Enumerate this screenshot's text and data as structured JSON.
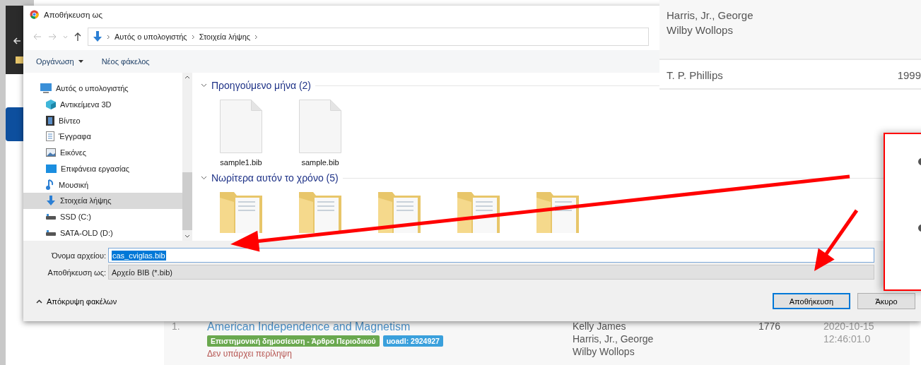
{
  "dialog": {
    "title": "Αποθήκευση ως",
    "breadcrumb": [
      "Αυτός ο υπολογιστής",
      "Στοιχεία λήψης"
    ],
    "toolbar": [
      {
        "label": "Οργάνωση",
        "dropdown": true
      },
      {
        "label": "Νέος φάκελος",
        "dropdown": false
      }
    ],
    "nav_items": [
      {
        "label": "Αυτός ο υπολογιστής",
        "kind": "computer",
        "selected": false
      },
      {
        "label": "Αντικείμενα 3D",
        "kind": "cube",
        "selected": false
      },
      {
        "label": "Βίντεο",
        "kind": "film",
        "selected": false
      },
      {
        "label": "Έγγραφα",
        "kind": "document",
        "selected": false
      },
      {
        "label": "Εικόνες",
        "kind": "picture",
        "selected": false
      },
      {
        "label": "Επιφάνεια εργασίας",
        "kind": "desktop",
        "selected": false
      },
      {
        "label": "Μουσική",
        "kind": "music",
        "selected": false
      },
      {
        "label": "Στοιχεία λήψης",
        "kind": "download",
        "selected": true
      },
      {
        "label": "SSD (C:)",
        "kind": "drive",
        "selected": false
      },
      {
        "label": "SATA-OLD (D:)",
        "kind": "drive",
        "selected": false
      }
    ],
    "groups": [
      {
        "title": "Προηγούμενο μήνα (2)",
        "items": [
          {
            "name": "sample1.bib",
            "kind": "file"
          },
          {
            "name": "sample.bib",
            "kind": "file"
          }
        ]
      },
      {
        "title": "Νωρίτερα αυτόν το χρόνο (5)",
        "items": [
          {
            "kind": "folder"
          },
          {
            "kind": "folder"
          },
          {
            "kind": "folder"
          },
          {
            "kind": "folder"
          },
          {
            "kind": "folder"
          }
        ]
      }
    ],
    "file_name": {
      "label": "Όνομα αρχείου:",
      "value": "cas_cviglas.bib"
    },
    "save_type": {
      "label": "Αποθήκευση ως:",
      "value": "Αρχείο BIB (*.bib)"
    },
    "hide_folders": "Απόκρυψη φακέλων",
    "buttons": [
      {
        "label": "Αποθήκευση",
        "default": true
      },
      {
        "label": "Άκυρο",
        "default": false
      }
    ]
  },
  "results_panel": {
    "rows": [
      {
        "authors": [
          "Harris, Jr., George",
          "Wilby Wollops"
        ],
        "shaded": true
      },
      {
        "authors": [
          "T. P. Phillips"
        ],
        "year": "1999",
        "shaded": false
      }
    ]
  },
  "result_list": [
    {
      "number": "1.",
      "title": "American Independence and Magnetism",
      "badges": [
        {
          "label": "Επιστημονική δημοσίευση - Άρθρο Περιοδικού",
          "color": "#6aa84f"
        },
        {
          "label": "uoadl: 2924927",
          "color": "#3aa0dc"
        }
      ],
      "note": "Δεν υπάρχει περίληψη",
      "authors": [
        "Kelly James",
        "Harris, Jr., George",
        "Wilby Wollops"
      ],
      "year": "1776",
      "date": [
        "2020-10-15",
        "12:46:01.0"
      ]
    }
  ]
}
